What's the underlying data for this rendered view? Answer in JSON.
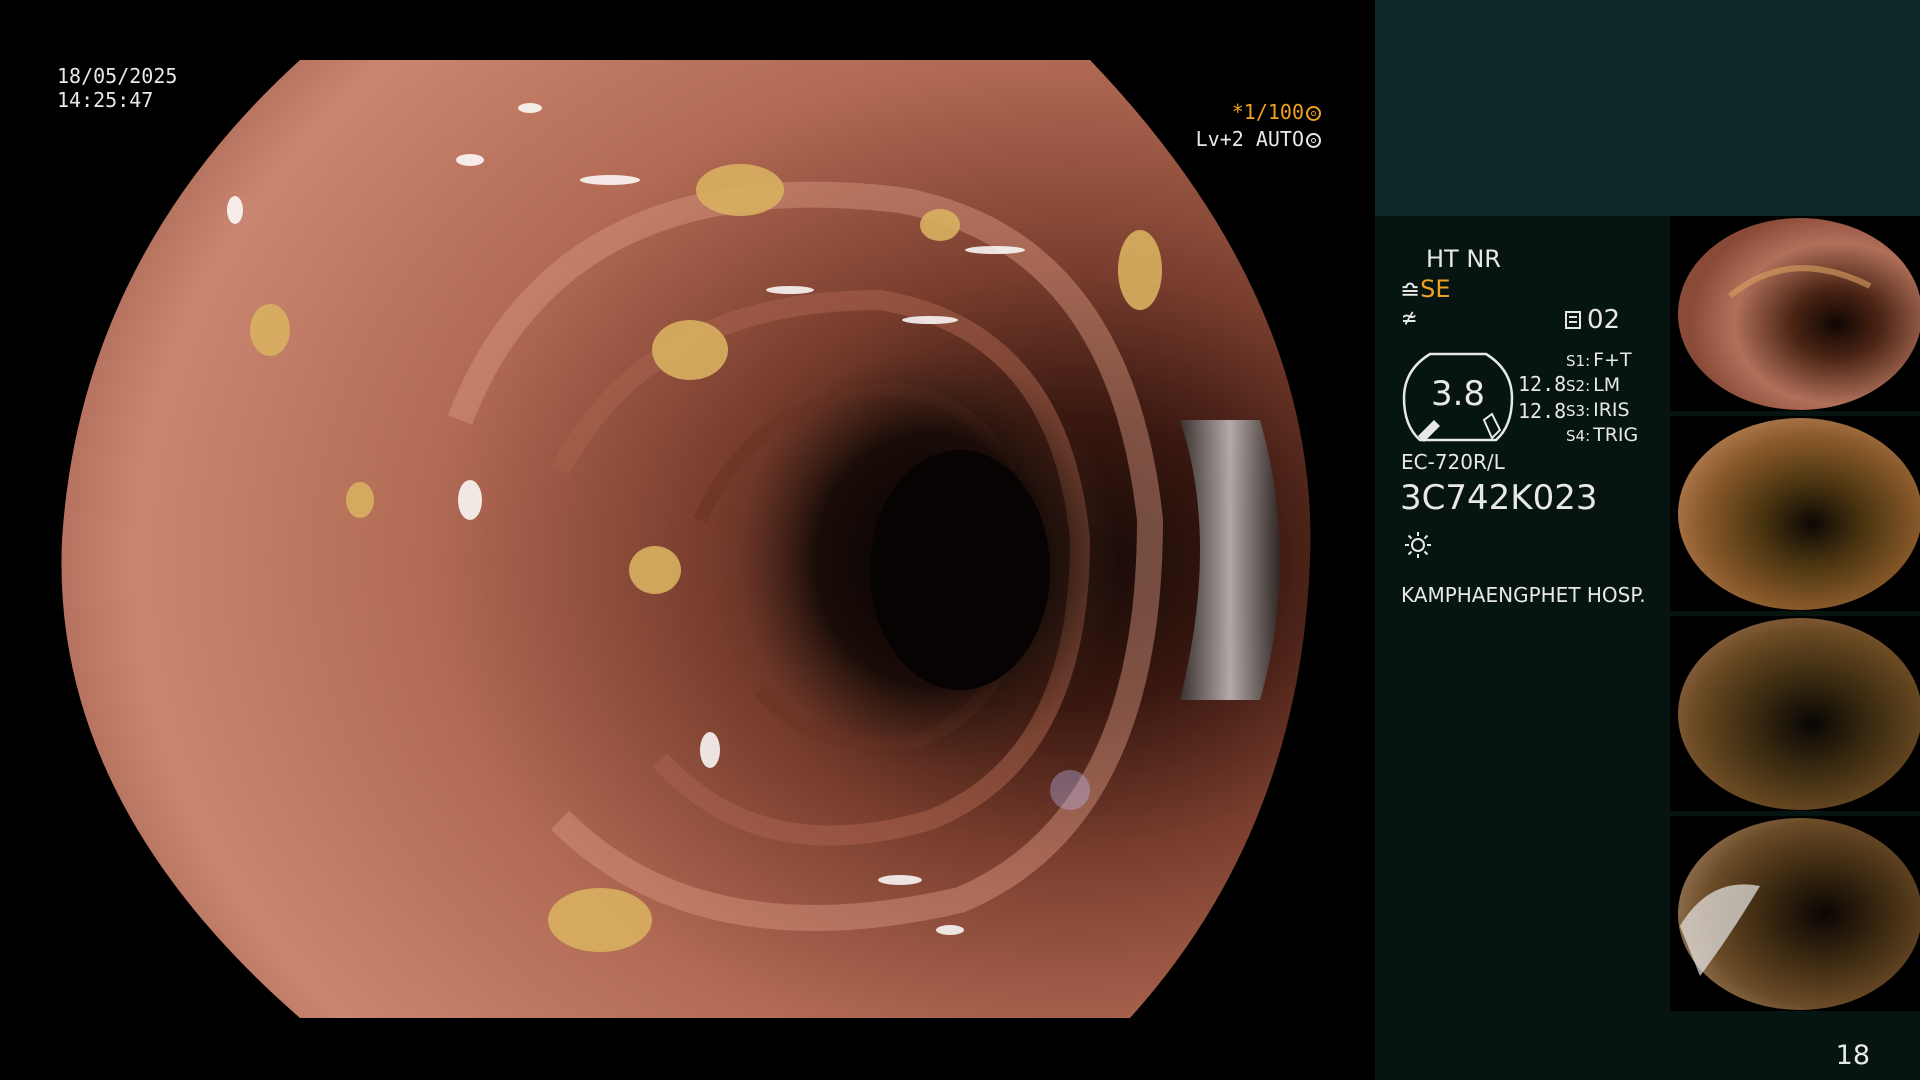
{
  "overlay": {
    "date": "18/05/2025",
    "time": "14:25:47",
    "shutter": "*1/100",
    "level": "Lv+2 AUTO"
  },
  "panel": {
    "mode_line": "HT NR",
    "se_label": "SE",
    "count": "02",
    "gauge_value": "3.8",
    "side_value_1": "12.8",
    "side_value_2": "12.8",
    "switches": [
      {
        "key": "S1:",
        "value": "F+T"
      },
      {
        "key": "S2:",
        "value": "LM"
      },
      {
        "key": "S3:",
        "value": "IRIS"
      },
      {
        "key": "S4:",
        "value": "TRIG"
      }
    ],
    "scope_model": "EC-720R/L",
    "serial": "3C742K023",
    "hospital": "KAMPHAENGPHET HOSP."
  },
  "page_number": "18",
  "colors": {
    "panel_top": "#0e2a28",
    "panel_main": "#061412",
    "accent": "#f0a020"
  },
  "icons": {
    "shutter": "aperture-icon",
    "level": "auto-iris-icon",
    "se": "enhancement-icon",
    "f": "filter-icon",
    "count": "capture-count-icon",
    "light": "light-source-icon"
  }
}
